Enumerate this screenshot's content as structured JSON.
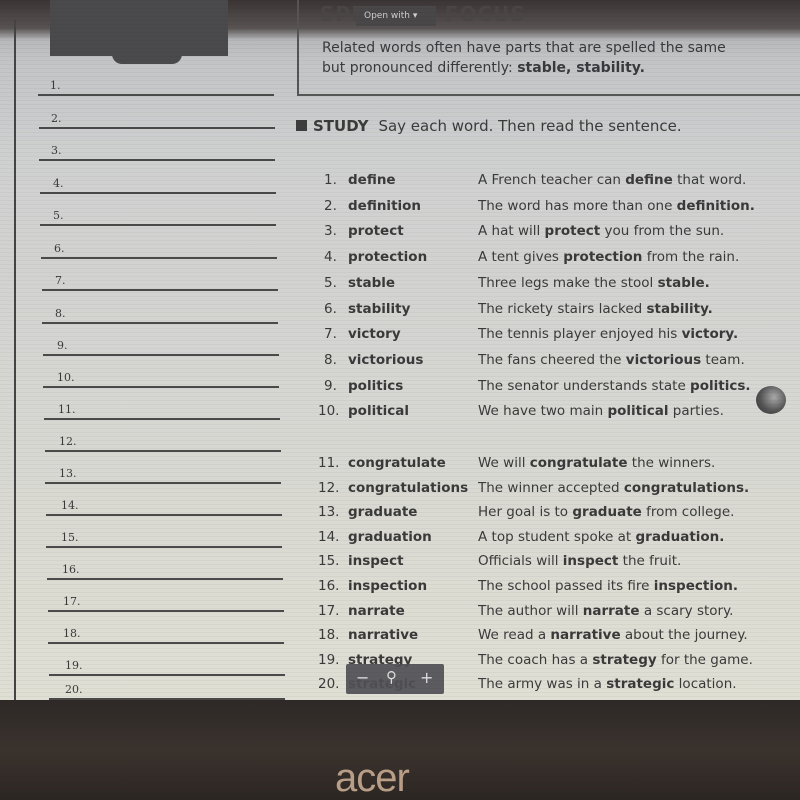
{
  "toolbar": {
    "open_with_label": "Open with ▾"
  },
  "focus": {
    "title": "SPELLING FOCUS",
    "text_line1": "Related words often have parts that are spelled the same",
    "text_line2_prefix": "but pronounced differently: ",
    "examples": "stable, stability."
  },
  "study": {
    "label": "STUDY",
    "instruction": "Say each word. Then read the sentence."
  },
  "answer_lines": [
    "1.",
    "2.",
    "3.",
    "4.",
    "5.",
    "6.",
    "7.",
    "8.",
    "9.",
    "10.",
    "11.",
    "12.",
    "13.",
    "14.",
    "15.",
    "16.",
    "17.",
    "18.",
    "19.",
    "20."
  ],
  "words": [
    {
      "num": "1.",
      "word": "define",
      "pre": "A French teacher can ",
      "bold": "define",
      "post": " that word."
    },
    {
      "num": "2.",
      "word": "definition",
      "pre": "The word has more than one ",
      "bold": "definition.",
      "post": ""
    },
    {
      "num": "3.",
      "word": "protect",
      "pre": "A hat will ",
      "bold": "protect",
      "post": " you from the sun."
    },
    {
      "num": "4.",
      "word": "protection",
      "pre": "A tent gives ",
      "bold": "protection",
      "post": " from the rain."
    },
    {
      "num": "5.",
      "word": "stable",
      "pre": "Three legs make the stool ",
      "bold": "stable.",
      "post": ""
    },
    {
      "num": "6.",
      "word": "stability",
      "pre": "The rickety stairs lacked ",
      "bold": "stability.",
      "post": ""
    },
    {
      "num": "7.",
      "word": "victory",
      "pre": "The tennis player enjoyed his ",
      "bold": "victory.",
      "post": ""
    },
    {
      "num": "8.",
      "word": "victorious",
      "pre": "The fans cheered the ",
      "bold": "victorious",
      "post": " team."
    },
    {
      "num": "9.",
      "word": "politics",
      "pre": "The senator understands state ",
      "bold": "politics.",
      "post": ""
    },
    {
      "num": "10.",
      "word": "political",
      "pre": "We have two main ",
      "bold": "political",
      "post": " parties."
    },
    {
      "num": "11.",
      "word": "congratulate",
      "pre": "We will ",
      "bold": "congratulate",
      "post": " the winners."
    },
    {
      "num": "12.",
      "word": "congratulations",
      "pre": "The winner accepted ",
      "bold": "congratulations.",
      "post": ""
    },
    {
      "num": "13.",
      "word": "graduate",
      "pre": "Her goal is to ",
      "bold": "graduate",
      "post": " from college."
    },
    {
      "num": "14.",
      "word": "graduation",
      "pre": "A top student spoke at ",
      "bold": "graduation.",
      "post": ""
    },
    {
      "num": "15.",
      "word": "inspect",
      "pre": "Officials will ",
      "bold": "inspect",
      "post": " the fruit."
    },
    {
      "num": "16.",
      "word": "inspection",
      "pre": "The school passed its fire ",
      "bold": "inspection.",
      "post": ""
    },
    {
      "num": "17.",
      "word": "narrate",
      "pre": "The author will ",
      "bold": "narrate",
      "post": " a scary story."
    },
    {
      "num": "18.",
      "word": "narrative",
      "pre": "We read a ",
      "bold": "narrative",
      "post": " about the journey."
    },
    {
      "num": "19.",
      "word": "strategy",
      "pre": "The coach has a ",
      "bold": "strategy",
      "post": " for the game."
    },
    {
      "num": "20.",
      "word": "strategic",
      "pre": "The army was in a ",
      "bold": "strategic",
      "post": " location."
    }
  ],
  "zoom_controls": {
    "minus": "−",
    "zoom_icon": "magnifier-icon",
    "plus": "+"
  },
  "bezel": {
    "brand": "acer"
  }
}
